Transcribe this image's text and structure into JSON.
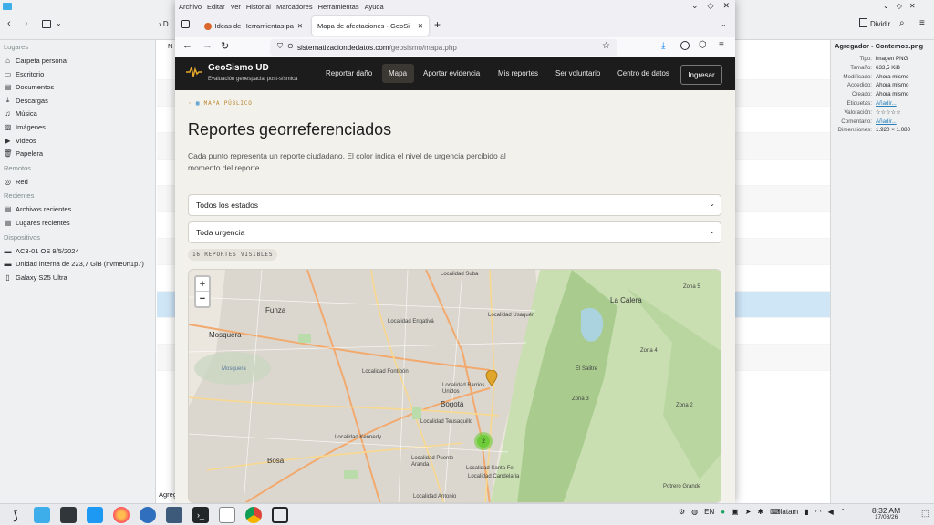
{
  "dolphin": {
    "sidebar": {
      "sections": [
        {
          "title": "Lugares",
          "items": [
            {
              "label": "Carpeta personal",
              "icon": "home-icon"
            },
            {
              "label": "Escritorio",
              "icon": "desktop-icon"
            },
            {
              "label": "Documentos",
              "icon": "documents-icon"
            },
            {
              "label": "Descargas",
              "icon": "downloads-icon"
            },
            {
              "label": "Música",
              "icon": "music-icon"
            },
            {
              "label": "Imágenes",
              "icon": "pictures-icon"
            },
            {
              "label": "Videos",
              "icon": "videos-icon"
            },
            {
              "label": "Papelera",
              "icon": "trash-icon"
            }
          ]
        },
        {
          "title": "Remotos",
          "items": [
            {
              "label": "Red",
              "icon": "network-icon"
            }
          ]
        },
        {
          "title": "Recientes",
          "items": [
            {
              "label": "Archivos recientes",
              "icon": "recent-files-icon"
            },
            {
              "label": "Lugares recientes",
              "icon": "recent-places-icon"
            }
          ]
        },
        {
          "title": "Dispositivos",
          "items": [
            {
              "label": "AC3-01 OS 9/5/2024",
              "icon": "drive-icon"
            },
            {
              "label": "Unidad interna de 223,7 GiB (nvme0n1p7)",
              "icon": "drive-icon"
            },
            {
              "label": "Galaxy S25 Ultra",
              "icon": "phone-icon"
            }
          ]
        }
      ]
    },
    "toolbar": {
      "split_label": "Dividir",
      "column_header": "N",
      "crumb": "D"
    },
    "status_text": "Agreg",
    "info_panel": {
      "title": "Agregador - Contemos.png",
      "rows": [
        {
          "key": "Tipo:",
          "value": "imagen PNG"
        },
        {
          "key": "Tamaño:",
          "value": "633,5 KiB"
        },
        {
          "key": "Modificado:",
          "value": "Ahora mismo"
        },
        {
          "key": "Accedido:",
          "value": "Ahora mismo"
        },
        {
          "key": "Creado:",
          "value": "Ahora mismo"
        },
        {
          "key": "Etiquetas:",
          "value": "Añadir...",
          "link": true
        },
        {
          "key": "Valoración:",
          "value": "☆☆☆☆☆"
        },
        {
          "key": "Comentario:",
          "value": "Añadir...",
          "link": true
        },
        {
          "key": "Dimensiones:",
          "value": "1.920 × 1.080"
        }
      ]
    }
  },
  "firefox": {
    "menu": [
      "Archivo",
      "Editar",
      "Ver",
      "Historial",
      "Marcadores",
      "Herramientas",
      "Ayuda"
    ],
    "tabs": [
      {
        "title": "Ideas de Herramientas pa",
        "active": false
      },
      {
        "title": "Mapa de afectaciones · GeoSi",
        "active": true
      }
    ],
    "url": {
      "host": "sistematizaciondedatos.com",
      "path": "/geosismo/mapa.php"
    }
  },
  "site": {
    "brand": "GeoSismo UD",
    "tagline": "Evaluación geoespacial post-sísmica",
    "nav": [
      "Reportar daño",
      "Mapa",
      "Aportar evidencia",
      "Mis reportes",
      "Ser voluntario",
      "Centro de datos"
    ],
    "active_nav": "Mapa",
    "login": "Ingresar",
    "eyebrow": "MAPA PÚBLICO",
    "title": "Reportes georreferenciados",
    "intro": "Cada punto representa un reporte ciudadano. El color indica el nivel de urgencia percibido al momento del reporte.",
    "filter_state": "Todos los estados",
    "filter_urgency": "Toda urgencia",
    "visible_count": "16 REPORTES VISIBLES",
    "map": {
      "zoom_in": "+",
      "zoom_out": "−",
      "cluster_count": "2",
      "labels": [
        "Localidad Suba",
        "Localidad Usaquén",
        "Funza",
        "Mosquera",
        "Localidad Engativá",
        "Localidad Fontibón",
        "Localidad Barrios Unidos",
        "Bogotá",
        "Localidad Teusaquillo",
        "Localidad Kennedy",
        "Localidad Puente Aranda",
        "Localidad Santa Fe",
        "Localidad Antonio",
        "Bosa",
        "La Calera",
        "Zona 5",
        "Zona 4",
        "El Salitre",
        "Zona 3",
        "Zona 2",
        "Localidad Candelaria",
        "Mosquera",
        "Potrero Grande"
      ]
    }
  },
  "taskbar": {
    "time": "8:32 AM",
    "date": "17/08/26",
    "keyboard": "latam",
    "lang": "EN"
  }
}
